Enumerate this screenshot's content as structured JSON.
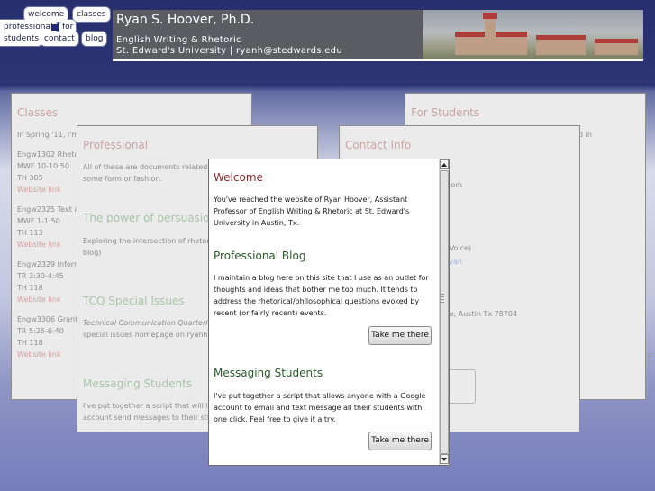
{
  "nav": {
    "welcome": "welcome",
    "classes": "classes",
    "professional": "professional",
    "for": "for",
    "students": "students",
    "contact": "contact",
    "blog": "blog"
  },
  "header": {
    "title": "Ryan S. Hoover, Ph.D.",
    "line1": "English Writing & Rhetoric",
    "line2": "St. Edward's University | ryanh@stedwards.edu"
  },
  "classes": {
    "title": "Classes",
    "intro": "In Spring '11, I'm",
    "courses": [
      {
        "code": "Engw1302 Rheto",
        "time": "MWF 10-10:50",
        "room": "TH 305",
        "link": "Website link"
      },
      {
        "code": "Engw2325 Text a",
        "time": "MWF 1-1:50",
        "room": "TH 113",
        "link": "Website link"
      },
      {
        "code": "Engw2329 Inform",
        "time": "TR 3:30-4:45",
        "room": "TH 118",
        "link": "Website link"
      },
      {
        "code": "Engw3306 Grant",
        "time": "TR 5:25-6:40",
        "room": "TH 118",
        "link": "Website link"
      }
    ]
  },
  "professional": {
    "title": "Professional",
    "intro_1": "All of these are documents related t",
    "intro_2": "some form or fashion.",
    "s1_title": "The power of persuasio",
    "s1_text_1": "Exploring the intersection of rhetori",
    "s1_text_2": "blog)",
    "s2_title": "TCQ Special Issues",
    "s2_text_1": "Technical Communication Quarterl",
    "s2_text_2": "special issues homepage on ryanh",
    "s3_title": "Messaging Students",
    "s3_text_1": "I've put together a script that will let",
    "s3_text_2": "account send messages to their stu"
  },
  "for_students": {
    "title": "For Students",
    "text_1": "d in",
    "text_2": "in"
  },
  "contact": {
    "title": "Contact Info",
    "email_frag": "il.com",
    "voice_frag": "le Voice)",
    "ryan_frag": "ryan",
    "address_frag": "Ave, Austin Tx 78704"
  },
  "dialog": {
    "welcome_title": "Welcome",
    "welcome_text": "You've reached the website of Ryan Hoover, Assistant Professor of English Writing & Rhetoric at St. Edward's University in Austin, Tx.",
    "blog_title": "Professional Blog",
    "blog_text": "I maintain a blog here on this site that I use as an outlet for thoughts and ideas that bother me too much. It tends to address the rhetorical/philosophical questions evoked by recent (or fairly recent) events.",
    "blog_button": "Take me there",
    "msg_title": "Messaging Students",
    "msg_text": "I've put together a script that allows anyone with a Google account to email and text message all their students with one click. Feel free to give it a try.",
    "msg_button": "Take me there"
  }
}
